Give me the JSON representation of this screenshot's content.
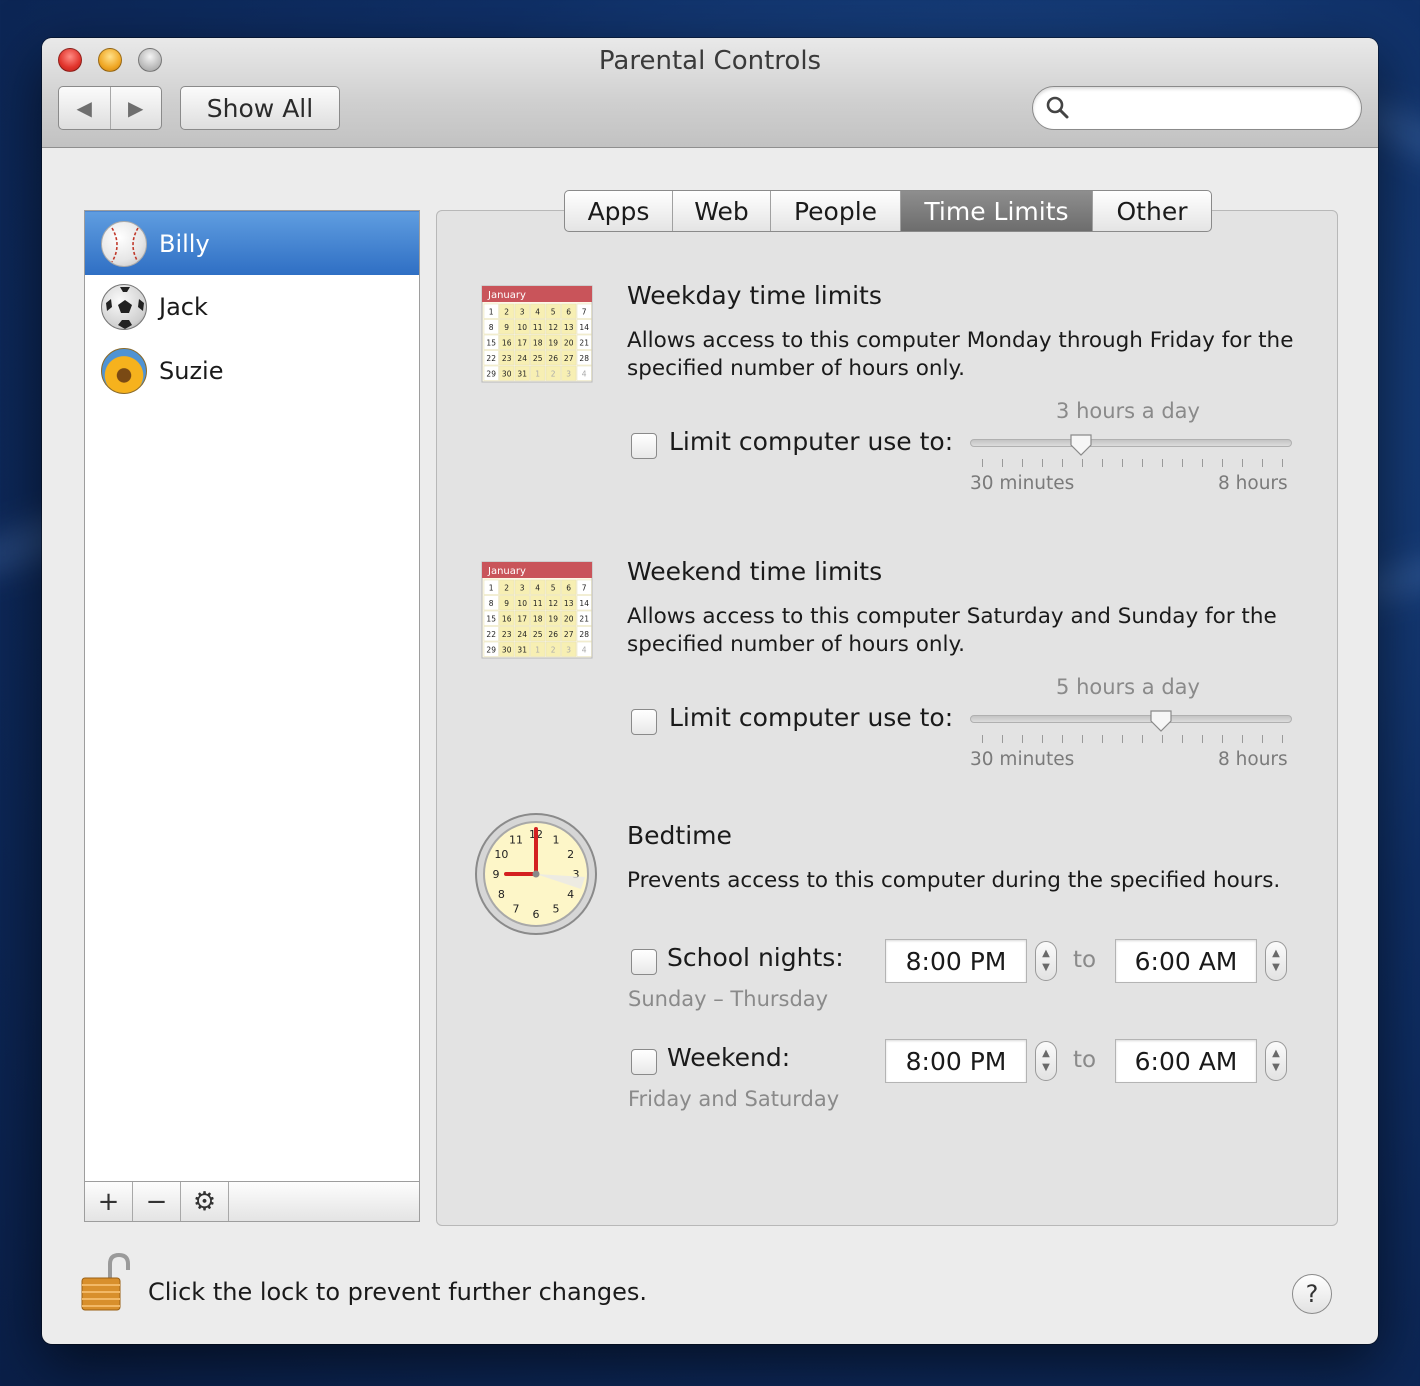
{
  "window": {
    "title": "Parental Controls"
  },
  "toolbar": {
    "back_icon": "◀",
    "forward_icon": "▶",
    "show_all_label": "Show All",
    "search_placeholder": ""
  },
  "users": [
    {
      "name": "Billy",
      "avatar": "baseball-icon",
      "selected": true
    },
    {
      "name": "Jack",
      "avatar": "soccer-ball-icon",
      "selected": false
    },
    {
      "name": "Suzie",
      "avatar": "sunflower-icon",
      "selected": false
    }
  ],
  "list_bar": {
    "add_label": "+",
    "remove_label": "−",
    "gear_label": "⚙"
  },
  "tabs": [
    {
      "label": "Apps",
      "active": false
    },
    {
      "label": "Web",
      "active": false
    },
    {
      "label": "People",
      "active": false
    },
    {
      "label": "Time Limits",
      "active": true
    },
    {
      "label": "Other",
      "active": false
    }
  ],
  "weekday": {
    "title": "Weekday time limits",
    "description": "Allows access to this computer Monday through Friday for the specified number of hours only.",
    "checkbox_label": "Limit computer use to:",
    "checked": false,
    "value_label": "3 hours a day",
    "value_hours": 3,
    "min_label": "30 minutes",
    "max_label": "8 hours"
  },
  "weekend": {
    "title": "Weekend time limits",
    "description": "Allows access to this computer Saturday and Sunday for the specified number of hours only.",
    "checkbox_label": "Limit computer use to:",
    "checked": false,
    "value_label": "5 hours a day",
    "value_hours": 5,
    "min_label": "30 minutes",
    "max_label": "8 hours"
  },
  "calendar_icon": {
    "month": "January",
    "days": [
      "1",
      "2",
      "3",
      "4",
      "5",
      "6",
      "7",
      "8",
      "9",
      "10",
      "11",
      "12",
      "13",
      "14",
      "15",
      "16",
      "17",
      "18",
      "19",
      "20",
      "21",
      "22",
      "23",
      "24",
      "25",
      "26",
      "27",
      "28",
      "29",
      "30",
      "31",
      "1",
      "2",
      "3",
      "4"
    ]
  },
  "clock_icon": {
    "numbers": [
      "12",
      "1",
      "2",
      "3",
      "4",
      "5",
      "6",
      "7",
      "8",
      "9",
      "10",
      "11"
    ]
  },
  "bedtime": {
    "title": "Bedtime",
    "description": "Prevents access to this computer during the specified hours.",
    "school_nights": {
      "label": "School nights:",
      "days": "Sunday – Thursday",
      "from": "8:00 PM",
      "to": "6:00 AM",
      "checked": false
    },
    "weekend": {
      "label": "Weekend:",
      "days": "Friday and Saturday",
      "from": "8:00 PM",
      "to": "6:00 AM",
      "checked": false
    },
    "to_label": "to"
  },
  "footer": {
    "lock_text": "Click the lock to prevent further changes.",
    "help_label": "?"
  }
}
